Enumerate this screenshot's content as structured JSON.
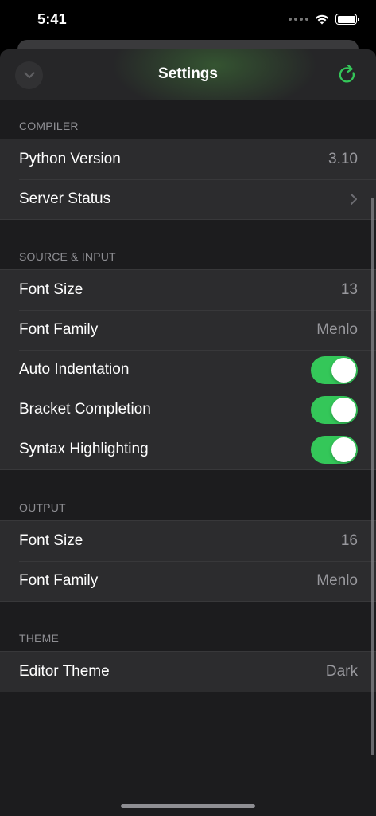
{
  "status_bar": {
    "time": "5:41"
  },
  "nav": {
    "title": "Settings"
  },
  "sections": [
    {
      "header": "COMPILER",
      "rows": [
        {
          "label": "Python Version",
          "value": "3.10"
        },
        {
          "label": "Server Status",
          "accessory": "chevron"
        }
      ]
    },
    {
      "header": "SOURCE & INPUT",
      "rows": [
        {
          "label": "Font Size",
          "value": "13"
        },
        {
          "label": "Font Family",
          "value": "Menlo"
        },
        {
          "label": "Auto Indentation",
          "toggle": true
        },
        {
          "label": "Bracket Completion",
          "toggle": true
        },
        {
          "label": "Syntax Highlighting",
          "toggle": true
        }
      ]
    },
    {
      "header": "OUTPUT",
      "rows": [
        {
          "label": "Font Size",
          "value": "16"
        },
        {
          "label": "Font Family",
          "value": "Menlo"
        }
      ]
    },
    {
      "header": "THEME",
      "rows": [
        {
          "label": "Editor Theme",
          "value": "Dark"
        }
      ]
    }
  ],
  "colors": {
    "accent_green": "#34c759",
    "background": "#1c1c1e",
    "cell": "#2c2c2e"
  },
  "icons": {
    "close": "chevron-down-icon",
    "refresh": "refresh-icon",
    "chevron": "chevron-right-icon"
  }
}
